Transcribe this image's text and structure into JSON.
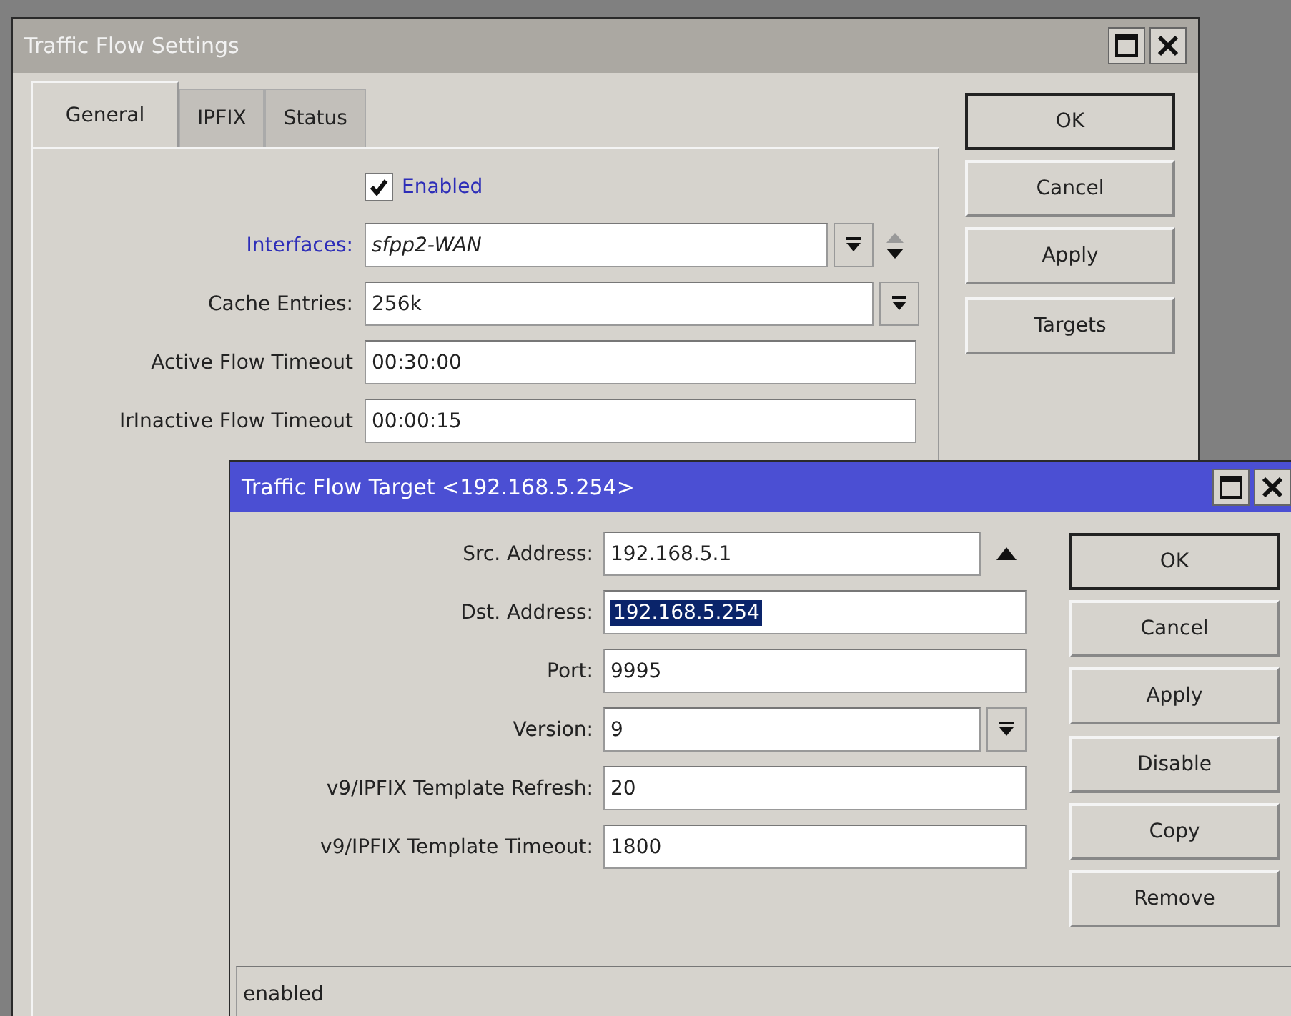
{
  "settings_window": {
    "title": "Traffic Flow Settings",
    "tabs": [
      {
        "label": "General",
        "selected": true
      },
      {
        "label": "IPFIX",
        "selected": false
      },
      {
        "label": "Status",
        "selected": false
      }
    ],
    "enabled": {
      "label": "Enabled",
      "checked": true
    },
    "fields": [
      {
        "kind": "multi",
        "label": "Interfaces:",
        "value": "sfpp2-WAN",
        "link": true
      },
      {
        "kind": "dropdown",
        "label": "Cache Entries:",
        "value": "256k",
        "link": false
      },
      {
        "kind": "text",
        "label": "Active Flow Timeout",
        "value": "00:30:00",
        "link": false
      },
      {
        "kind": "text",
        "label": "IrInactive Flow Timeout",
        "value": "00:00:15",
        "link": false
      }
    ],
    "button_groups": [
      [
        {
          "label": "OK",
          "default": true
        },
        {
          "label": "Cancel",
          "default": false
        },
        {
          "label": "Apply",
          "default": false
        }
      ],
      [
        {
          "label": "Targets",
          "default": false
        }
      ]
    ]
  },
  "target_window": {
    "title": "Traffic Flow Target <192.168.5.254>",
    "fields": [
      {
        "kind": "expand",
        "label": "Src. Address:",
        "value": "192.168.5.1",
        "highlighted": false
      },
      {
        "kind": "text",
        "label": "Dst. Address:",
        "value": "192.168.5.254",
        "highlighted": true
      },
      {
        "kind": "text",
        "label": "Port:",
        "value": "9995",
        "highlighted": false
      },
      {
        "kind": "dropdown",
        "label": "Version:",
        "value": "9",
        "highlighted": false
      },
      {
        "kind": "text",
        "label": "v9/IPFIX Template Refresh:",
        "value": "20",
        "highlighted": false
      },
      {
        "kind": "text",
        "label": "v9/IPFIX Template Timeout:",
        "value": "1800",
        "highlighted": false
      }
    ],
    "button_groups": [
      [
        {
          "label": "OK",
          "default": true
        },
        {
          "label": "Cancel",
          "default": false
        },
        {
          "label": "Apply",
          "default": false
        }
      ],
      [
        {
          "label": "Disable",
          "default": false
        },
        {
          "label": "Copy",
          "default": false
        },
        {
          "label": "Remove",
          "default": false
        }
      ]
    ],
    "status": "enabled"
  }
}
